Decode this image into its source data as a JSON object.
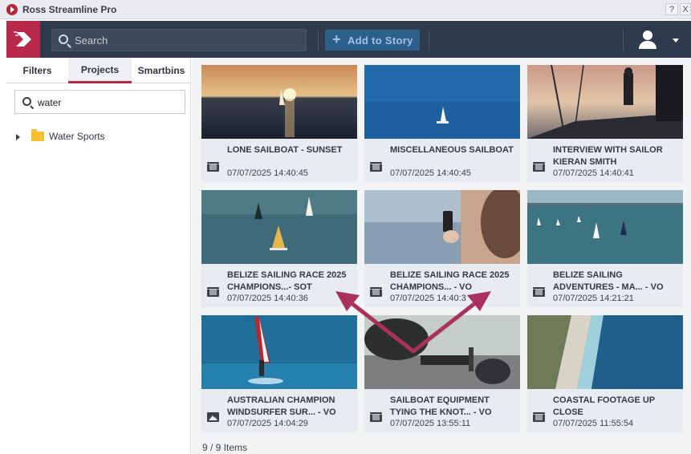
{
  "window": {
    "title": "Ross Streamline Pro",
    "help": "?",
    "close": "X"
  },
  "toolbar": {
    "search_placeholder": "Search",
    "add_story_label": "Add to Story"
  },
  "left": {
    "tabs": [
      "Filters",
      "Projects",
      "Smartbins"
    ],
    "active_tab": "Projects",
    "filter_value": "water",
    "tree": [
      {
        "label": "Water Sports",
        "icon": "folder-icon"
      }
    ]
  },
  "grid": {
    "items": [
      {
        "title": "LONE SAILBOAT - SUNSET",
        "date": "07/07/2025 14:40:45",
        "type": "video"
      },
      {
        "title": "MISCELLANEOUS SAILBOAT",
        "date": "07/07/2025 14:40:45",
        "type": "video"
      },
      {
        "title": "INTERVIEW WITH SAILOR KIERAN SMITH",
        "date": "07/07/2025 14:40:41",
        "type": "video"
      },
      {
        "title": "BELIZE SAILING RACE 2025 CHAMPIONS...- SOT",
        "date": "07/07/2025 14:40:36",
        "type": "video"
      },
      {
        "title": "BELIZE SAILING RACE 2025 CHAMPIONS... - VO",
        "date": "07/07/2025 14:40:3",
        "type": "video"
      },
      {
        "title": "BELIZE SAILING ADVENTURES - MA... - VO",
        "date": "07/07/2025 14:21:21",
        "type": "video"
      },
      {
        "title": "AUSTRALIAN CHAMPION WINDSURFER SUR... - VO",
        "date": "07/07/2025 14:04:29",
        "type": "image"
      },
      {
        "title": "SAILBOAT EQUIPMENT TYING THE KNOT... - VO",
        "date": "07/07/2025 13:55:11",
        "type": "video"
      },
      {
        "title": "COASTAL FOOTAGE UP CLOSE",
        "date": "07/07/2025 11:55:54",
        "type": "video"
      }
    ],
    "status": "9 / 9 Items"
  },
  "colors": {
    "accent": "#b8294a",
    "toolbar": "#2f3b4c",
    "add_story": "#2d5f8d",
    "annotation_arrow": "#a8325c"
  }
}
